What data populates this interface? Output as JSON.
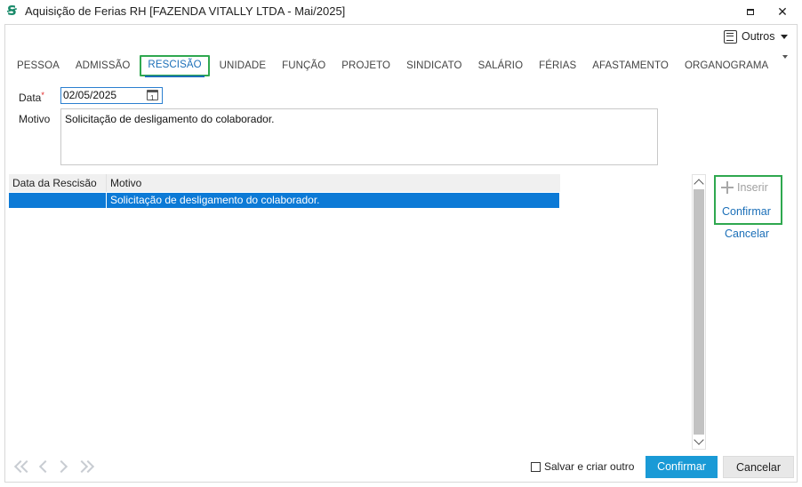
{
  "window": {
    "title": "Aquisição de Ferias RH [FAZENDA VITALLY LTDA - Mai/2025]",
    "logo_glyph": "Ꞩ",
    "maximize_icon": "maximize-icon",
    "close_glyph": "✕"
  },
  "toolbar": {
    "outros_label": "Outros"
  },
  "tabs": [
    {
      "label": "PESSOA"
    },
    {
      "label": "ADMISSÃO"
    },
    {
      "label": "RESCISÃO",
      "active": true
    },
    {
      "label": "UNIDADE"
    },
    {
      "label": "FUNÇÃO"
    },
    {
      "label": "PROJETO"
    },
    {
      "label": "SINDICATO"
    },
    {
      "label": "SALÁRIO"
    },
    {
      "label": "FÉRIAS"
    },
    {
      "label": "AFASTAMENTO"
    },
    {
      "label": "ORGANOGRAMA"
    }
  ],
  "form": {
    "data_label": "Data",
    "required_mark": "*",
    "data_value": "02/05/2025",
    "motivo_label": "Motivo",
    "motivo_value": "Solicitação de desligamento do colaborador."
  },
  "grid": {
    "columns": [
      "Data da Rescisão",
      "Motivo"
    ],
    "rows": [
      {
        "data": "",
        "motivo": "Solicitação de desligamento do colaborador.",
        "selected": true
      }
    ]
  },
  "actions": {
    "inserir": "Inserir",
    "confirmar": "Confirmar",
    "cancelar": "Cancelar"
  },
  "footer": {
    "save_create_label": "Salvar e criar outro",
    "confirm_button": "Confirmar",
    "cancel_button": "Cancelar"
  },
  "colors": {
    "accent": "#1b6fb8",
    "selection": "#0c7ad6",
    "confirm_button": "#1a9ad6",
    "highlight_box": "#2fa84f"
  }
}
